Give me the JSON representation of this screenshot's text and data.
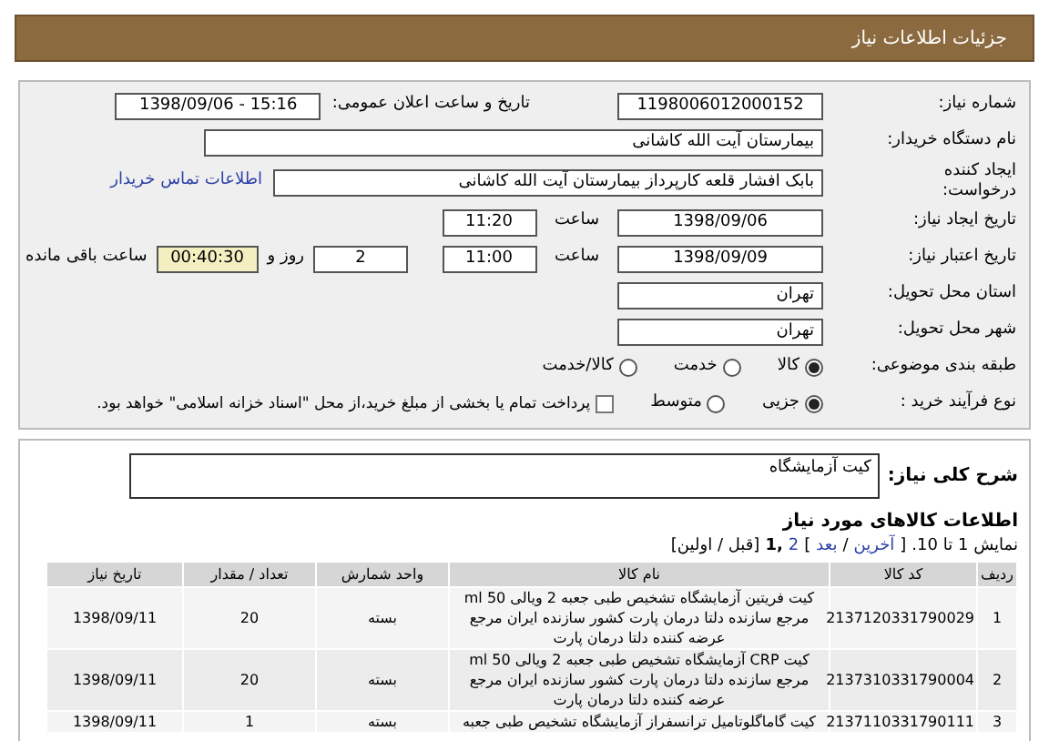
{
  "header": {
    "title": "جزئیات اطلاعات نیاز"
  },
  "form": {
    "need_number": {
      "label": "شماره نیاز:",
      "value": "1198006012000152"
    },
    "announce": {
      "label": "تاریخ و ساعت اعلان عمومی:",
      "value": "1398/09/06 - 15:16"
    },
    "buyer": {
      "label": "نام دستگاه خریدار:",
      "value": "بیمارستان آیت الله کاشانی"
    },
    "creator": {
      "label": "ایجاد کننده درخواست:",
      "value": "بابک افشار قلعه کارپرداز بیمارستان آیت الله کاشانی",
      "link": "اطلاعات تماس خریدار"
    },
    "created": {
      "label": "تاریخ ایجاد نیاز:",
      "date": "1398/09/06",
      "time_label": "ساعت",
      "time": "11:20"
    },
    "valid": {
      "label": "تاریخ اعتبار نیاز:",
      "date": "1398/09/09",
      "time_label": "ساعت",
      "time": "11:00",
      "days": "2",
      "days_label": "روز و",
      "remaining": "00:40:30",
      "remaining_label": "ساعت باقی مانده"
    },
    "province": {
      "label": "استان محل تحویل:",
      "value": "تهران"
    },
    "city": {
      "label": "شهر محل تحویل:",
      "value": "تهران"
    },
    "category": {
      "label": "طبقه بندی موضوعی:",
      "options": [
        {
          "label": "کالا",
          "selected": true
        },
        {
          "label": "خدمت",
          "selected": false
        },
        {
          "label": "کالا/خدمت",
          "selected": false
        }
      ]
    },
    "process": {
      "label": "نوع فرآیند خرید :",
      "options": [
        {
          "label": "جزیی",
          "selected": true
        },
        {
          "label": "متوسط",
          "selected": false
        }
      ],
      "treasury": {
        "label": "پرداخت تمام یا بخشی از مبلغ خرید،از محل \"اسناد خزانه اسلامی\" خواهد بود.",
        "checked": false
      }
    }
  },
  "description": {
    "label": "شرح کلی نیاز:",
    "value": "کیت آزمایشگاه"
  },
  "goods": {
    "title": "اطلاعات کالاهای مورد نیاز",
    "pagination": [
      {
        "kind": "text",
        "text": "نمایش 1 تا 10."
      },
      {
        "kind": "text",
        "text": "["
      },
      {
        "kind": "link",
        "text": "آخرین"
      },
      {
        "kind": "text",
        "text": "/"
      },
      {
        "kind": "link",
        "text": "بعد"
      },
      {
        "kind": "text",
        "text": "]"
      },
      {
        "kind": "link",
        "text": "2"
      },
      {
        "kind": "current",
        "text": ",1"
      },
      {
        "kind": "text",
        "text": "[قبل / اولین]"
      }
    ],
    "columns": [
      "ردیف",
      "کد کالا",
      "نام کالا",
      "واحد شمارش",
      "تعداد / مقدار",
      "تاریخ نیاز"
    ],
    "rows": [
      {
        "cells": [
          "1",
          "2137120331790029",
          "کیت فریتین آزمایشگاه تشخیص طبی جعبه 2 ویالی 50 ml مرجع سازنده دلتا درمان پارت کشور سازنده ایران مرجع عرضه کننده دلتا درمان پارت",
          "بسته",
          "20",
          "1398/09/11"
        ]
      },
      {
        "cells": [
          "2",
          "2137310331790004",
          "کیت CRP آزمایشگاه تشخیص طبی جعبه 2 ویالی 50 ml مرجع سازنده دلتا درمان پارت کشور سازنده ایران مرجع عرضه کننده دلتا درمان پارت",
          "بسته",
          "20",
          "1398/09/11"
        ]
      },
      {
        "cells": [
          "3",
          "2137110331790111",
          "کیت گاماگلوتامیل ترانسفراز آزمایشگاه تشخیص طبی جعبه",
          "بسته",
          "1",
          "1398/09/11"
        ]
      }
    ]
  }
}
